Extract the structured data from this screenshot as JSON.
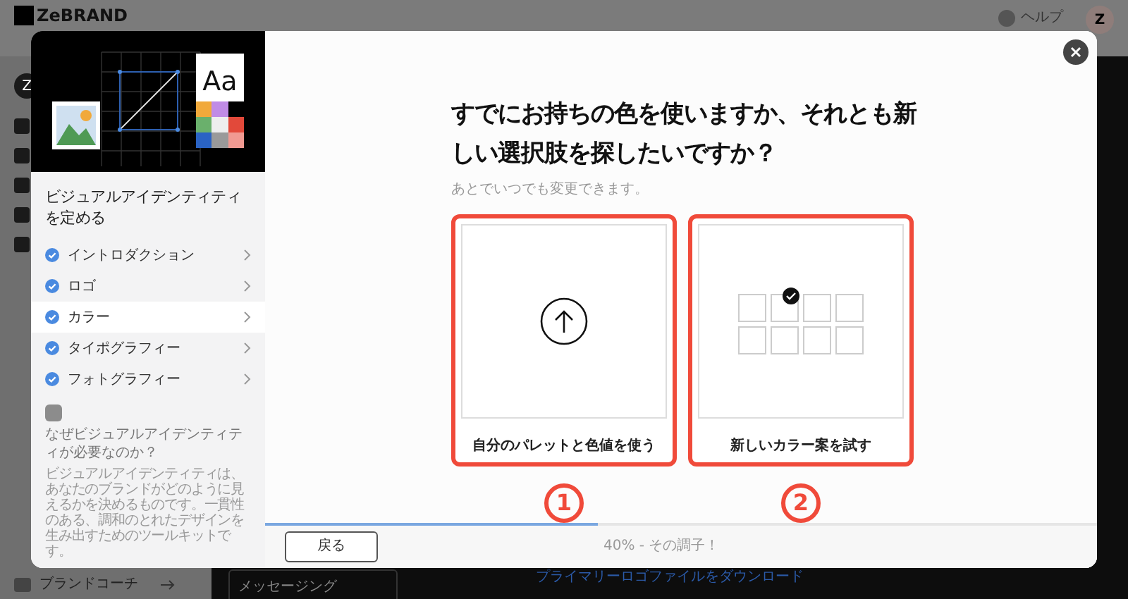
{
  "background": {
    "logo": "ZeBRAND",
    "help": "ヘルプ",
    "avatar": "Z",
    "sidebar_avatar": "Z",
    "coach": "ブランドコーチ",
    "messaging": "メッセージング",
    "download_link": "プライマリーロゴファイルをダウンロード"
  },
  "modal": {
    "illustration_text": "Aa",
    "sidebar": {
      "title": "ビジュアルアイデンティティを定める",
      "steps": [
        {
          "label": "イントロダクション",
          "done": true,
          "selected": false
        },
        {
          "label": "ロゴ",
          "done": true,
          "selected": false
        },
        {
          "label": "カラー",
          "done": true,
          "selected": true
        },
        {
          "label": "タイポグラフィー",
          "done": true,
          "selected": false
        },
        {
          "label": "フォトグラフィー",
          "done": true,
          "selected": false
        }
      ],
      "tip_title": "なぜビジュアルアイデンティティが必要なのか？",
      "tip_text": "ビジュアルアイデンティティは、あなたのブランドがどのように見えるかを決めるものです。一貫性のある、調和のとれたデザインを生み出すためのツールキットです。"
    },
    "question": "すでにお持ちの色を使いますか、それとも新しい選択肢を探したいですか？",
    "subtitle": "あとでいつでも変更できます。",
    "options": [
      {
        "kind": "upload",
        "label": "自分のパレットと色値を使う",
        "annotation": "1"
      },
      {
        "kind": "palette",
        "label": "新しいカラー案を試す",
        "annotation": "2"
      }
    ],
    "back_button": "戻る",
    "progress": {
      "level": 0.4,
      "text": "40% - その調子！"
    }
  }
}
